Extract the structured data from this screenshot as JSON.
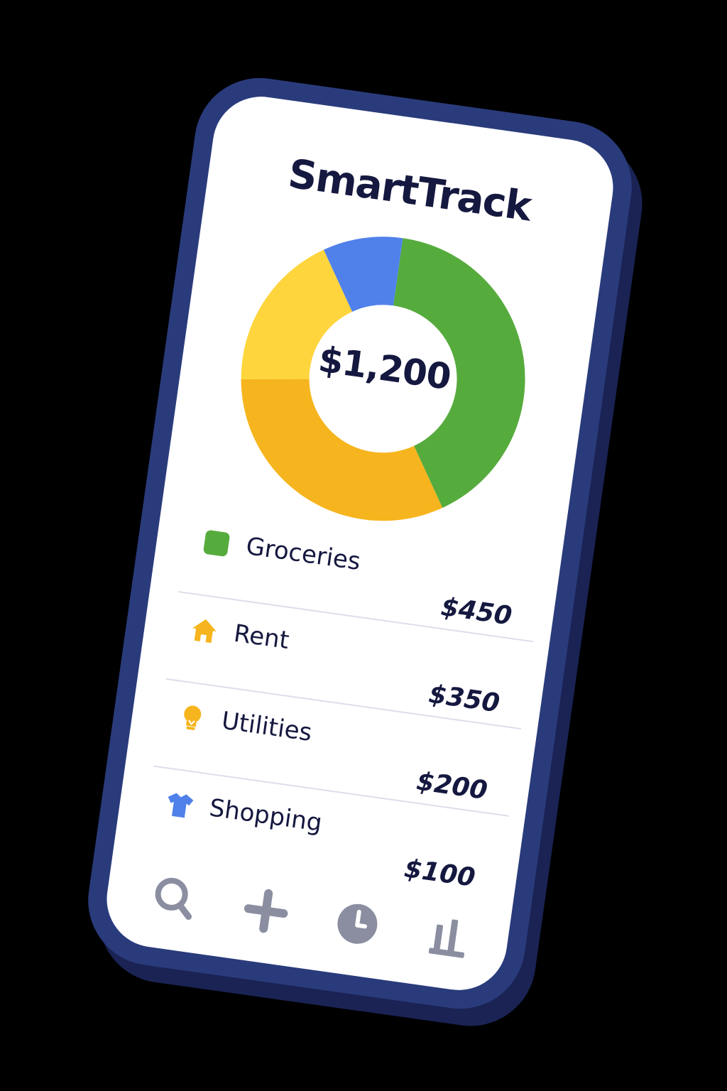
{
  "app": {
    "title": "SmartTrack"
  },
  "summary": {
    "total": "$1,200"
  },
  "chart_data": {
    "type": "pie",
    "center_label": "$1,200",
    "slices": [
      {
        "label": "Groceries",
        "value": 450,
        "color": "#56ab3d"
      },
      {
        "label": "Rent",
        "value": 350,
        "color": "#f6b51e"
      },
      {
        "label": "Utilities",
        "value": 200,
        "color": "#fed53d"
      },
      {
        "label": "Shopping",
        "value": 100,
        "color": "#5081ea"
      }
    ]
  },
  "categories": [
    {
      "label": "Groceries",
      "amount": "$450",
      "icon": "square-icon",
      "color": "#56ab3d"
    },
    {
      "label": "Rent",
      "amount": "$350",
      "icon": "house-icon",
      "color": "#f6b51e"
    },
    {
      "label": "Utilities",
      "amount": "$200",
      "icon": "lightbulb-icon",
      "color": "#f6b51e"
    },
    {
      "label": "Shopping",
      "amount": "$100",
      "icon": "shirt-icon",
      "color": "#5081ea"
    }
  ],
  "nav": {
    "items": [
      {
        "icon": "search-icon"
      },
      {
        "icon": "plus-icon"
      },
      {
        "icon": "clock-icon"
      },
      {
        "icon": "bar-chart-icon"
      }
    ],
    "color": "#8a8ea0"
  },
  "theme": {
    "frame": "#2a3b7c",
    "text": "#15183f"
  }
}
